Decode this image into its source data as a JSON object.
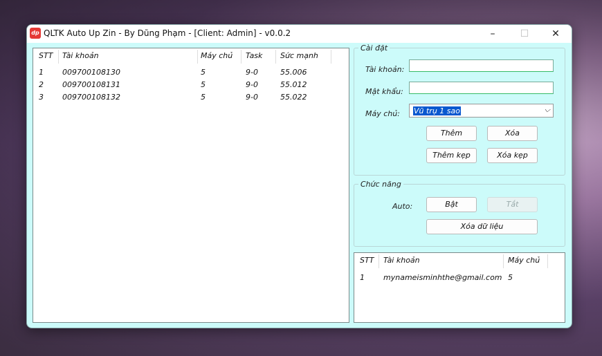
{
  "window": {
    "title": "QLTK Auto Up Zin - By Dũng Phạm - [Client: Admin] - v0.0.2",
    "icon_label": "dp"
  },
  "controls": {
    "minimize": "–",
    "maximize": "☐",
    "close": "✕"
  },
  "accounts_table": {
    "headers": [
      "STT",
      "Tài khoản",
      "Máy chủ",
      "Task",
      "Sức mạnh"
    ],
    "rows": [
      [
        "1",
        "009700108130",
        "5",
        "9-0",
        "55.006"
      ],
      [
        "2",
        "009700108131",
        "5",
        "9-0",
        "55.012"
      ],
      [
        "3",
        "009700108132",
        "5",
        "9-0",
        "55.022"
      ]
    ]
  },
  "settings": {
    "legend": "Cài đặt",
    "account_label": "Tài khoản:",
    "account_value": "",
    "password_label": "Mật khẩu:",
    "password_value": "",
    "server_label": "Máy chủ:",
    "server_selected": "Vũ trụ 1 sao",
    "add": "Thêm",
    "delete": "Xóa",
    "add_multi": "Thêm kẹp",
    "delete_multi": "Xóa kẹp"
  },
  "functions": {
    "legend": "Chức năng",
    "auto_label": "Auto:",
    "on": "Bật",
    "off": "Tắt",
    "clear_data": "Xóa dữ liệu"
  },
  "email_table": {
    "headers": [
      "STT",
      "Tài khoản",
      "Máy chủ"
    ],
    "rows": [
      [
        "1",
        "mynameisminhthe@gmail.com",
        "5"
      ]
    ]
  }
}
